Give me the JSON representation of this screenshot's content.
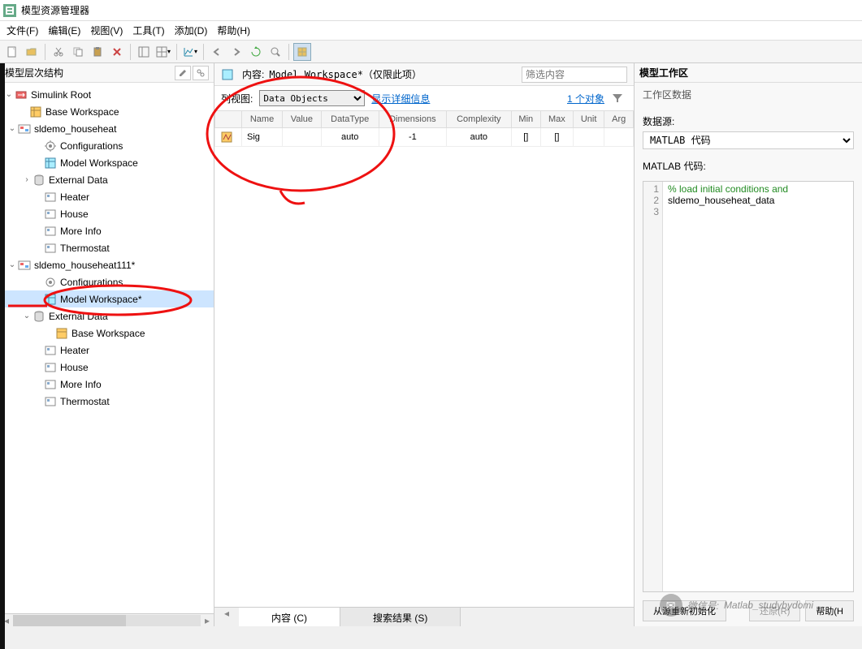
{
  "window": {
    "title": "模型资源管理器"
  },
  "menu": {
    "file": "文件(F)",
    "edit": "编辑(E)",
    "view": "视图(V)",
    "tools": "工具(T)",
    "add": "添加(D)",
    "help": "帮助(H)"
  },
  "left": {
    "header": "模型层次结构",
    "root": "Simulink Root",
    "base": "Base Workspace",
    "model1": {
      "name": "sldemo_househeat",
      "cfg": "Configurations",
      "mw": "Model Workspace",
      "ext": "External Data",
      "heater": "Heater",
      "house": "House",
      "more": "More Info",
      "thermo": "Thermostat"
    },
    "model2": {
      "name": "sldemo_househeat111*",
      "cfg": "Configurations",
      "mw": "Model Workspace*",
      "ext": "External Data",
      "basews": "Base Workspace",
      "heater": "Heater",
      "house": "House",
      "more": "More Info",
      "thermo": "Thermostat"
    }
  },
  "center": {
    "content_label": "内容:",
    "content_value": "Model Workspace*（仅限此项）",
    "filter_placeholder": "筛选内容",
    "colview_label": "列视图:",
    "colview_value": "Data Objects",
    "show_details": "显示详细信息",
    "object_count": "1 个对象",
    "columns": {
      "name": "Name",
      "value": "Value",
      "datatype": "DataType",
      "dimensions": "Dimensions",
      "complexity": "Complexity",
      "min": "Min",
      "max": "Max",
      "unit": "Unit",
      "arg": "Arg"
    },
    "row": {
      "name": "Sig",
      "value": "",
      "datatype": "auto",
      "dimensions": "-1",
      "complexity": "auto",
      "min": "[]",
      "max": "[]",
      "unit": "",
      "arg": ""
    },
    "tabs": {
      "content": "内容 (C)",
      "search": "搜索结果 (S)"
    }
  },
  "right": {
    "header": "模型工作区",
    "section": "工作区数据",
    "datasource_label": "数据源:",
    "datasource_value": "MATLAB 代码",
    "code_label": "MATLAB 代码:",
    "code_line1": "% load initial conditions and",
    "code_line2": "sldemo_househeat_data",
    "reinit_btn": "从源重新初始化",
    "revert_btn": "还原(R)",
    "help_btn": "帮助(H"
  },
  "watermark": {
    "label": "微信号:",
    "id": "Matlab_studybydomi"
  }
}
